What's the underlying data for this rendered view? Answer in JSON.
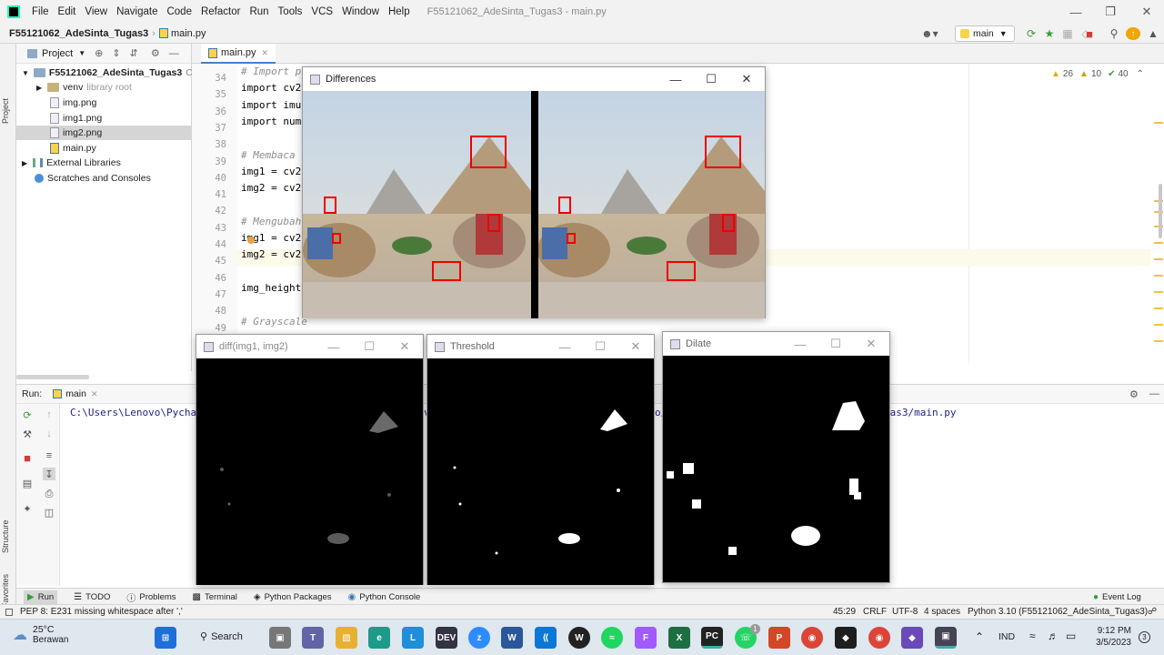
{
  "menu": {
    "items": [
      "File",
      "Edit",
      "View",
      "Navigate",
      "Code",
      "Refactor",
      "Run",
      "Tools",
      "VCS",
      "Window",
      "Help"
    ],
    "window_title": "F55121062_AdeSinta_Tugas3 - main.py"
  },
  "nav": {
    "project": "F55121062_AdeSinta_Tugas3",
    "file": "main.py",
    "run_config": "main"
  },
  "project_panel": {
    "label": "Project",
    "root": "F55121062_AdeSinta_Tugas3",
    "root_path": "C:\\",
    "items": [
      {
        "name": "venv",
        "note": "library root"
      },
      {
        "name": "img.png"
      },
      {
        "name": "img1.png"
      },
      {
        "name": "img2.png"
      },
      {
        "name": "main.py"
      },
      {
        "name": "External Libraries"
      },
      {
        "name": "Scratches and Consoles"
      }
    ]
  },
  "editor": {
    "tab": "main.py",
    "warnings": "26",
    "weak_warnings": "10",
    "typos": "40",
    "lines": [
      {
        "n": "34",
        "t": "# Import p",
        "c": true
      },
      {
        "n": "35",
        "t": "import cv2",
        "c": false
      },
      {
        "n": "36",
        "t": "import imu",
        "c": false
      },
      {
        "n": "37",
        "t": "import num",
        "c": false
      },
      {
        "n": "38",
        "t": "",
        "c": false
      },
      {
        "n": "39",
        "t": "# Membaca",
        "c": true
      },
      {
        "n": "40",
        "t": "img1 = cv2",
        "c": false
      },
      {
        "n": "41",
        "t": "img2 = cv2",
        "c": false
      },
      {
        "n": "42",
        "t": "",
        "c": false
      },
      {
        "n": "43",
        "t": "# Mengubah",
        "c": true
      },
      {
        "n": "44",
        "t": "img1 = cv2",
        "c": false
      },
      {
        "n": "45",
        "t": "img2 = cv2",
        "c": false
      },
      {
        "n": "46",
        "t": "",
        "c": false
      },
      {
        "n": "47",
        "t": "img_height",
        "c": false
      },
      {
        "n": "48",
        "t": "",
        "c": false
      },
      {
        "n": "49",
        "t": "# Grayscale",
        "c": true
      }
    ]
  },
  "run": {
    "label": "Run:",
    "tab": "main",
    "console_left": "C:\\Users\\Lenovo\\Pycha",
    "console_mid1": "v",
    "console_mid2": "o/",
    "console_right": "gas3/main.py"
  },
  "toolstrip": [
    "Run",
    "TODO",
    "Problems",
    "Terminal",
    "Python Packages",
    "Python Console"
  ],
  "event_log": "Event Log",
  "status": {
    "message": "PEP 8: E231 missing whitespace after ','",
    "position": "45:29",
    "line_sep": "CRLF",
    "encoding": "UTF-8",
    "indent": "4 spaces",
    "interpreter": "Python 3.10 (F55121062_AdeSinta_Tugas3)"
  },
  "windows": {
    "differences": "Differences",
    "diff": "diff(img1, img2)",
    "threshold": "Threshold",
    "dilate": "Dilate"
  },
  "taskbar": {
    "temp": "25°C",
    "weather": "Berawan",
    "search": "Search",
    "lang": "IND",
    "time": "9:12 PM",
    "date": "3/5/2023",
    "notif": "3",
    "badge": "1"
  },
  "side_tabs": [
    "Project",
    "Structure",
    "Favorites"
  ]
}
